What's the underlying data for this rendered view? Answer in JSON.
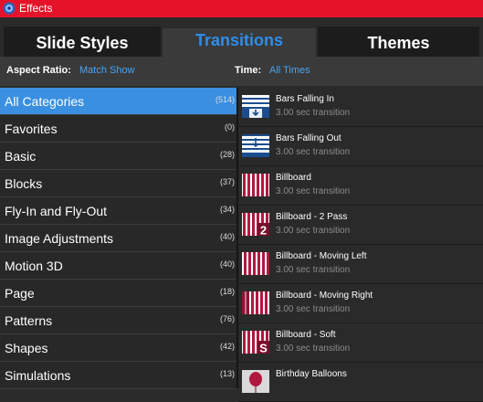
{
  "window": {
    "title": "Effects"
  },
  "tabs": {
    "slide_styles": "Slide Styles",
    "transitions": "Transitions",
    "themes": "Themes"
  },
  "options": {
    "aspect_label": "Aspect Ratio:",
    "aspect_value": "Match Show",
    "time_label": "Time:",
    "time_value": "All Times"
  },
  "categories": [
    {
      "name": "All Categories",
      "count": "(514)",
      "selected": true
    },
    {
      "name": "Favorites",
      "count": "(0)"
    },
    {
      "name": "Basic",
      "count": "(28)"
    },
    {
      "name": "Blocks",
      "count": "(37)"
    },
    {
      "name": "Fly-In and Fly-Out",
      "count": "(34)"
    },
    {
      "name": "Image Adjustments",
      "count": "(40)"
    },
    {
      "name": "Motion 3D",
      "count": "(40)"
    },
    {
      "name": "Page",
      "count": "(18)"
    },
    {
      "name": "Patterns",
      "count": "(76)"
    },
    {
      "name": "Shapes",
      "count": "(42)"
    },
    {
      "name": "Simulations",
      "count": "(13)"
    }
  ],
  "transitions": [
    {
      "name": "Bars Falling In",
      "duration": "3.00 sec transition",
      "icon": "bars-falling-in-icon"
    },
    {
      "name": "Bars Falling Out",
      "duration": "3.00 sec transition",
      "icon": "bars-falling-out-icon"
    },
    {
      "name": "Billboard",
      "duration": "3.00 sec transition",
      "icon": "billboard-icon"
    },
    {
      "name": "Billboard - 2 Pass",
      "duration": "3.00 sec transition",
      "icon": "billboard-2-pass-icon"
    },
    {
      "name": "Billboard - Moving Left",
      "duration": "3.00 sec transition",
      "icon": "billboard-moving-left-icon"
    },
    {
      "name": "Billboard - Moving Right",
      "duration": "3.00 sec transition",
      "icon": "billboard-moving-right-icon"
    },
    {
      "name": "Billboard - Soft",
      "duration": "3.00 sec transition",
      "icon": "billboard-soft-icon"
    },
    {
      "name": "Birthday Balloons",
      "duration": "",
      "icon": "birthday-balloons-icon"
    }
  ],
  "colors": {
    "titlebar": "#e5132a",
    "accent": "#3a8fe0",
    "link": "#4aa3f0",
    "billboard": "#b01840"
  }
}
